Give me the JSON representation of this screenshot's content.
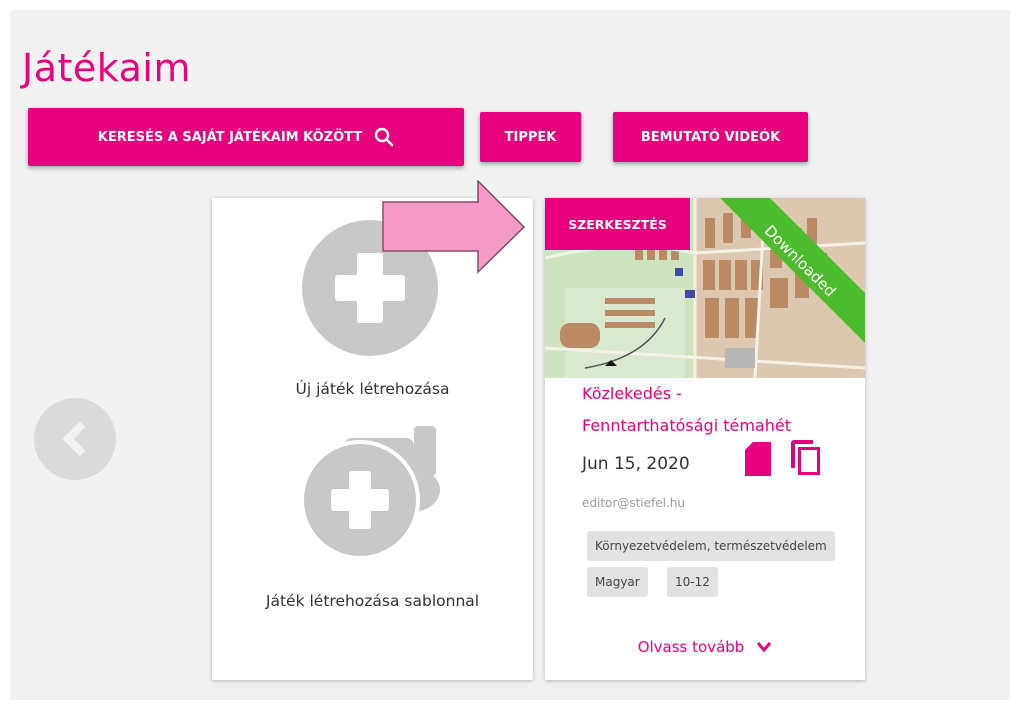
{
  "page": {
    "title": "Játékaim"
  },
  "toolbar": {
    "search_label": "KERESÉS A SAJÁT JÁTÉKAIM KÖZÖTT",
    "tips_label": "TIPPEK",
    "videos_label": "BEMUTATÓ VIDEÓK"
  },
  "create_card": {
    "new_game_label": "Új játék létrehozása",
    "template_label": "Játék létrehozása sablonnal"
  },
  "game_card": {
    "edit_label": "SZERKESZTÉS",
    "ribbon_label": "Downloaded",
    "title_line1": "Közlekedés -",
    "title_line2": "Fenntarthatósági témahét",
    "date": "Jun 15, 2020",
    "author": "editor@stiefel.hu",
    "tags": [
      "Környezetvédelem, természetvédelem",
      "Magyar",
      "10-12"
    ],
    "read_more_label": "Olvass tovább"
  },
  "icons": {
    "search": "search-icon",
    "prev": "chevron-left-icon",
    "plus": "plus-icon",
    "template": "template-plus-icon",
    "file": "file-icon",
    "copy": "copy-icon",
    "read_more": "chevron-down-icon"
  },
  "colors": {
    "accent": "#e6007e",
    "annotation_arrow": "#f49ac6"
  }
}
